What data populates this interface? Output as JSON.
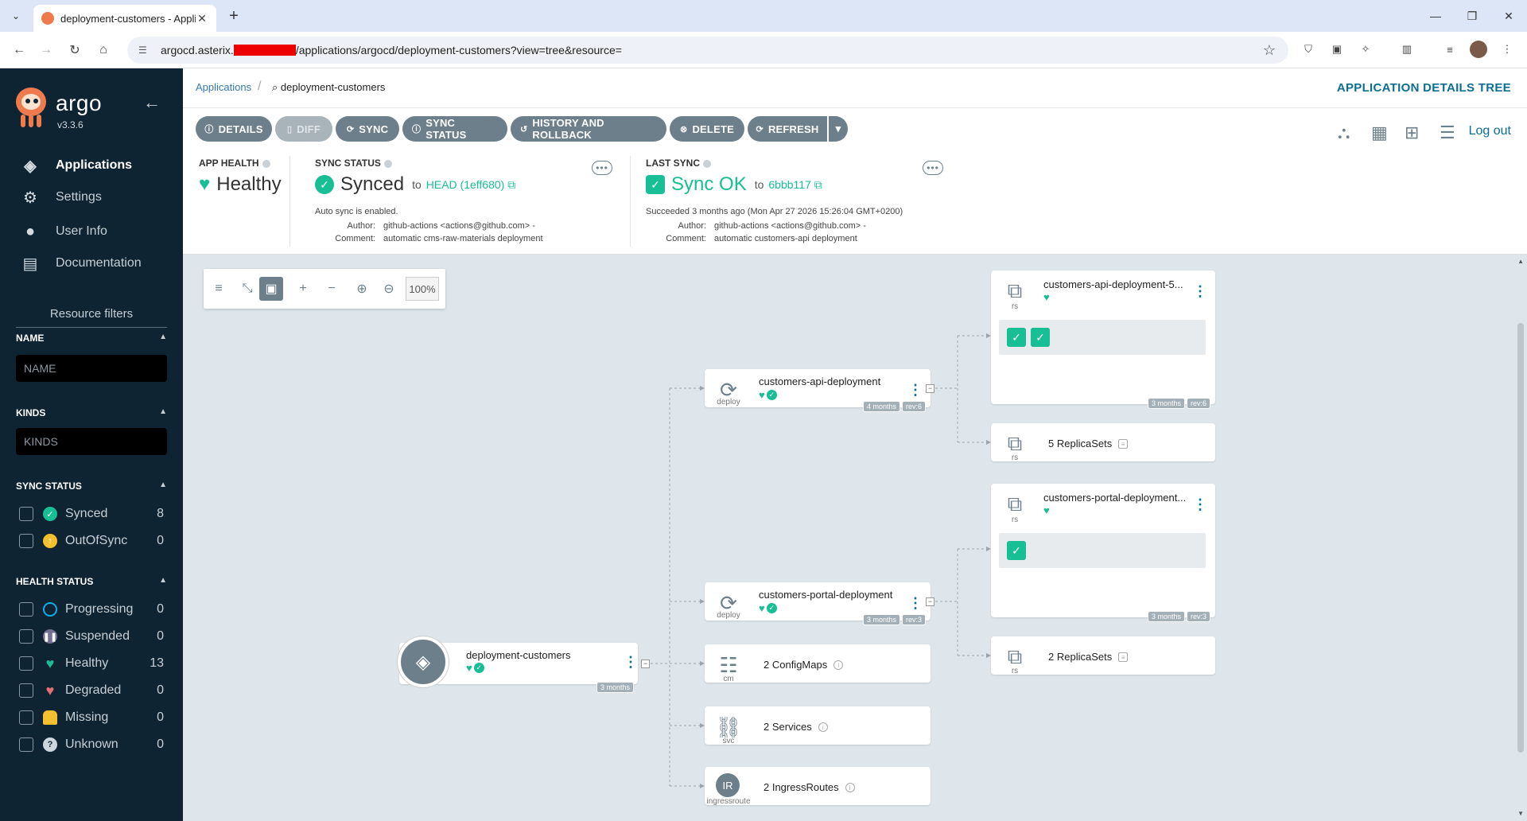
{
  "browser": {
    "tab_title": "deployment-customers - Applic",
    "url_prefix": "argocd.asterix.",
    "url_suffix": "/applications/argocd/deployment-customers?view=tree&resource="
  },
  "sidebar": {
    "brand": "argo",
    "version": "v3.3.6",
    "nav": [
      {
        "label": "Applications",
        "icon": "layers-icon"
      },
      {
        "label": "Settings",
        "icon": "gear-icon"
      },
      {
        "label": "User Info",
        "icon": "user-icon"
      },
      {
        "label": "Documentation",
        "icon": "book-icon"
      }
    ],
    "filters_title": "Resource filters",
    "name_header": "NAME",
    "name_placeholder": "NAME",
    "kinds_header": "KINDS",
    "kinds_placeholder": "KINDS",
    "sync_header": "SYNC STATUS",
    "sync_items": [
      {
        "label": "Synced",
        "count": "8",
        "color": "#18be94"
      },
      {
        "label": "OutOfSync",
        "count": "0",
        "color": "#f4c030"
      }
    ],
    "health_header": "HEALTH STATUS",
    "health_items": [
      {
        "label": "Progressing",
        "count": "0",
        "color": "#0dadea"
      },
      {
        "label": "Suspended",
        "count": "0",
        "color": "#766f94"
      },
      {
        "label": "Healthy",
        "count": "13",
        "color": "#18be94"
      },
      {
        "label": "Degraded",
        "count": "0",
        "color": "#e96d76"
      },
      {
        "label": "Missing",
        "count": "0",
        "color": "#f4c030"
      },
      {
        "label": "Unknown",
        "count": "0",
        "color": "#ccd6dd"
      }
    ]
  },
  "header": {
    "breadcrumb_root": "Applications",
    "breadcrumb_current": "deployment-customers",
    "title": "APPLICATION DETAILS TREE",
    "logout": "Log out"
  },
  "actions": [
    "DETAILS",
    "DIFF",
    "SYNC",
    "SYNC STATUS",
    "HISTORY AND ROLLBACK",
    "DELETE",
    "REFRESH"
  ],
  "status": {
    "app_health_label": "APP HEALTH",
    "app_health": "Healthy",
    "sync_status_label": "SYNC STATUS",
    "sync_status": "Synced",
    "sync_to": "to",
    "sync_rev": "HEAD (1eff680)",
    "auto_sync": "Auto sync is enabled.",
    "author_key": "Author:",
    "comment_key": "Comment:",
    "sync_author": "github-actions <actions@github.com> -",
    "sync_comment": "automatic cms-raw-materials deployment",
    "last_sync_label": "LAST SYNC",
    "last_sync": "Sync OK",
    "last_sync_to": "to",
    "last_sync_rev": "6bbb117",
    "last_sync_time": "Succeeded 3 months ago (Mon Apr 27 2026 15:26:04 GMT+0200)",
    "last_author": "github-actions <actions@github.com> -",
    "last_comment": "automatic customers-api deployment"
  },
  "graph": {
    "zoom": "100%",
    "app": {
      "name": "deployment-customers",
      "age": "3 months"
    },
    "deploy_api": {
      "name": "customers-api-deployment",
      "kind": "deploy",
      "age": "4 months",
      "rev": "rev:6"
    },
    "deploy_portal": {
      "name": "customers-portal-deployment",
      "kind": "deploy",
      "age": "3 months",
      "rev": "rev:3"
    },
    "configmaps": {
      "label": "2 ConfigMaps",
      "kind": "cm"
    },
    "services": {
      "label": "2 Services",
      "kind": "svc"
    },
    "ingress": {
      "label": "2 IngressRoutes",
      "kind": "ingressroute",
      "icon_text": "IR"
    },
    "rs_api": {
      "name": "customers-api-deployment-5...",
      "kind": "rs",
      "age": "3 months",
      "rev": "rev:6"
    },
    "rs_api_group": {
      "label": "5 ReplicaSets",
      "kind": "rs"
    },
    "rs_portal": {
      "name": "customers-portal-deployment...",
      "kind": "rs",
      "age": "3 months",
      "rev": "rev:3"
    },
    "rs_portal_group": {
      "label": "2 ReplicaSets",
      "kind": "rs"
    }
  }
}
